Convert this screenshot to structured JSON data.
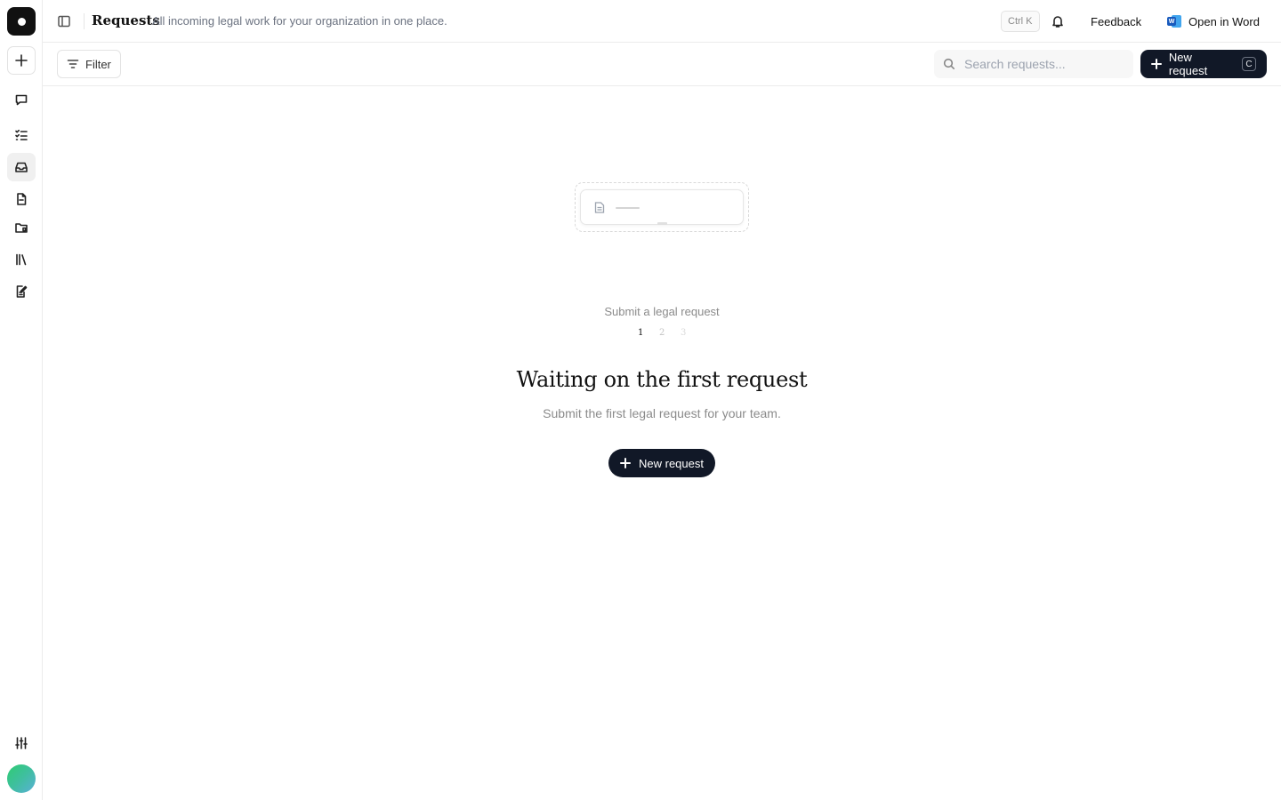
{
  "topbar": {
    "title": "Requests",
    "subtitle": "All incoming legal work for your organization in one place.",
    "shortcut": "Ctrl K",
    "feedback_label": "Feedback",
    "open_word_label": "Open in Word"
  },
  "sidebar": {
    "items": [
      {
        "icon": "chat-icon",
        "label": "Chat"
      },
      {
        "icon": "tasks-icon",
        "label": "Tasks"
      },
      {
        "icon": "inbox-icon",
        "label": "Requests",
        "active": true
      },
      {
        "icon": "document-icon",
        "label": "Documents"
      },
      {
        "icon": "folder-icon",
        "label": "Folders"
      },
      {
        "icon": "library-icon",
        "label": "Library"
      },
      {
        "icon": "edit-document-icon",
        "label": "Drafting"
      }
    ]
  },
  "toolbar": {
    "filter_label": "Filter",
    "search_placeholder": "Search requests...",
    "new_request_label": "New request",
    "new_request_shortcut": "C"
  },
  "empty_state": {
    "step_label": "Submit a legal request",
    "steps": [
      "1",
      "2",
      "3"
    ],
    "heading": "Waiting on the first request",
    "description": "Submit the first legal request for your team.",
    "button_label": "New request"
  },
  "colors": {
    "primary": "#111827",
    "border": "#ececec",
    "muted_text": "#8b8b8b"
  }
}
